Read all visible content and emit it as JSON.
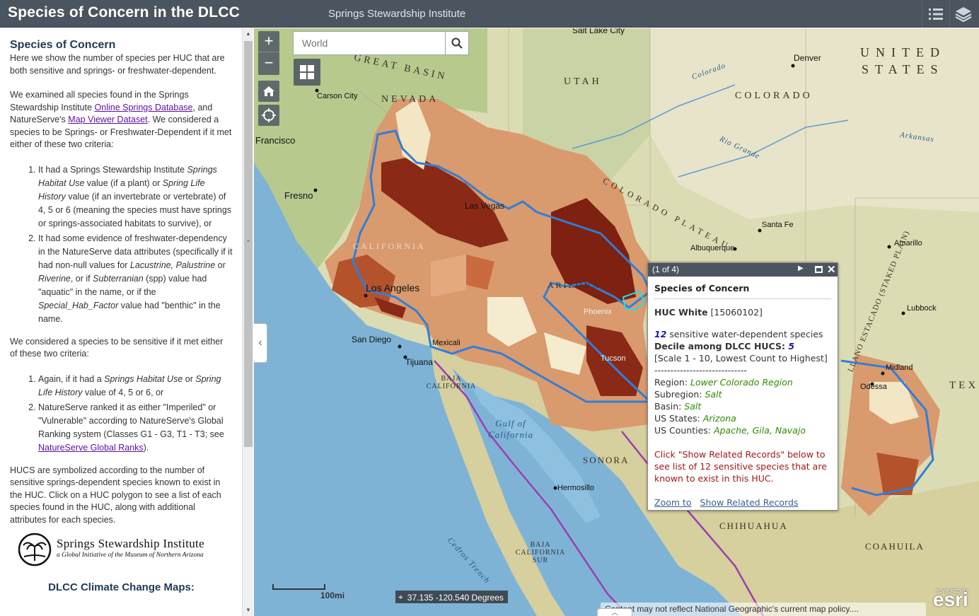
{
  "header": {
    "title": "Species of Concern in the DLCC",
    "subtitle": "Springs Stewardship Institute",
    "list_icon": "list-icon",
    "layers_icon": "layers-icon"
  },
  "sidebar": {
    "heading": "Species of Concern",
    "intro": "Here we show the number of species per HUC that are both sensitive and springs- or freshwater-dependent.",
    "examined_pre": "We examined all species found in the Springs Stewardship Institute ",
    "link_springs_db": "Online Springs Database",
    "examined_mid": ", and NatureServe's ",
    "link_map_viewer": "Map Viewer Dataset",
    "examined_post": ".  We considered a species to be Springs- or Freshwater-Dependent if it met either of these two criteria:",
    "criteria1_a": "It had a Springs Stewardship Institute ",
    "criteria1_b": "Springs Habitat Use",
    "criteria1_c": " value (if a plant) or ",
    "criteria1_d": "Spring Life History",
    "criteria1_e": " value (if an invertebrate or vertebrate) of 4, 5 or 6 (meaning the species must have springs or springs-associated habitats to survive), or",
    "criteria2_a": "It had some evidence of freshwater-dependency in the NatureServe data attributes (specifically if it had non-null values for ",
    "criteria2_b": "Lacustrine, Palustrine",
    "criteria2_c": " or ",
    "criteria2_d": "Riverine",
    "criteria2_e": ", or if ",
    "criteria2_f": "Subterranian",
    "criteria2_g": " (spp) value had \"aquatic\" in the name, or if the ",
    "criteria2_h": "Special_Hab_Factor",
    "criteria2_i": " value had \"benthic\" in the name.",
    "sensitive_intro": "We considered a species to be sensitive if it met either of these two criteria:",
    "sens1_a": "Again, if it had a ",
    "sens1_b": "Springs Habitat Use",
    "sens1_c": " or ",
    "sens1_d": "Spring Life History",
    "sens1_e": " value of 4, 5 or 6, or",
    "sens2_a": "NatureServe ranked it as either \"Imperiled\" or \"Vulnerable\" according to NatureServe's Global Ranking system (Classes G1 - G3, T1 - T3; see ",
    "link_global_ranks": "NatureServe Global Ranks",
    "sens2_b": ").",
    "hucs_text": "HUCS are symbolized according to the number of sensitive springs-dependent species known to exist in the HUC.  Click on a HUC polygon to see a list of each species found in the HUC, along with additional attributes for each species.",
    "logo_title": "Springs Stewardship Institute",
    "logo_sub": "a Global Initiative of the Museum of Northern Arizona",
    "climate_heading": "DLCC Climate Change Maps:"
  },
  "map": {
    "search_placeholder": "World",
    "zoom_in": "+",
    "zoom_out": "−",
    "scale_label": "100mi",
    "coords": "37.135 -120.540 Degrees",
    "attribution": "Content may not reflect National Geographic's current map policy....",
    "esri": "esri",
    "esri_powered": "POWERED BY",
    "labels": {
      "salt_lake": "Salt Lake City",
      "denver": "Denver",
      "united": "UNITED",
      "states": "STATES",
      "colorado_state": "COLORADO",
      "great_basin": "GREAT BASIN",
      "nevada": "NEVADA",
      "utah": "UTAH",
      "carson": "Carson City",
      "francisco": "Francisco",
      "fresno": "Fresno",
      "las_vegas": "Las Vegas",
      "los_angeles": "Los Angeles",
      "san_diego": "San Diego",
      "tijuana": "Tijuana",
      "mexicali": "Mexicali",
      "baja": "BAJA CALIFORNIA",
      "gulf": "Gulf of California",
      "sonora": "SONORA",
      "hermosillo": "Hermosillo",
      "chihuahua": "CHIHUAHUA",
      "baja_sur": "BAJA CALIFORNIA SUR",
      "cedros": "Cedros Trench",
      "coahuila": "COAHUILA",
      "santa_fe": "Santa Fe",
      "albuquerque": "Albuquerque",
      "amarillo": "Amarillo",
      "lubbock": "Lubbock",
      "midland": "Midland",
      "odessa": "Odessa",
      "tex": "TEX",
      "arizona": "ARIZONA",
      "phoenix": "Phoenix",
      "tucson": "Tucson",
      "california": "CALIFORNIA",
      "colorado_river": "Colorado",
      "arkansas": "Arkansas",
      "rio_grande": "Rio Grande",
      "colorado_plateau": "COLORADO PLATEAU",
      "staked_plain": "LLANO ESTACADO (STAKED PLAIN)"
    }
  },
  "popup": {
    "count": "(1 of 4)",
    "title": "Species of Concern",
    "huc_name": "HUC White",
    "huc_id": "[15060102]",
    "species_count": "12",
    "species_text": " sensitive water-dependent species",
    "decile_label": "Decile among DLCC HUCS",
    "decile_value": "5",
    "scale_note": "[Scale 1 - 10, Lowest Count to Highest]",
    "divider": "-----------------------------",
    "region_label": "Region: ",
    "region": "Lower Colorado Region",
    "subregion_label": "Subregion: ",
    "subregion": "Salt",
    "basin_label": "Basin: ",
    "basin": "Salt",
    "states_label": "US States: ",
    "states": "Arizona",
    "counties_label": "US Counties: ",
    "counties": "Apache, Gila, Navajo",
    "instruction": "Click \"Show Related Records\" below to see list of 12 sensitive species that are known to exist in this HUC.",
    "zoom_to": "Zoom to",
    "show_related": "Show Related Records"
  }
}
